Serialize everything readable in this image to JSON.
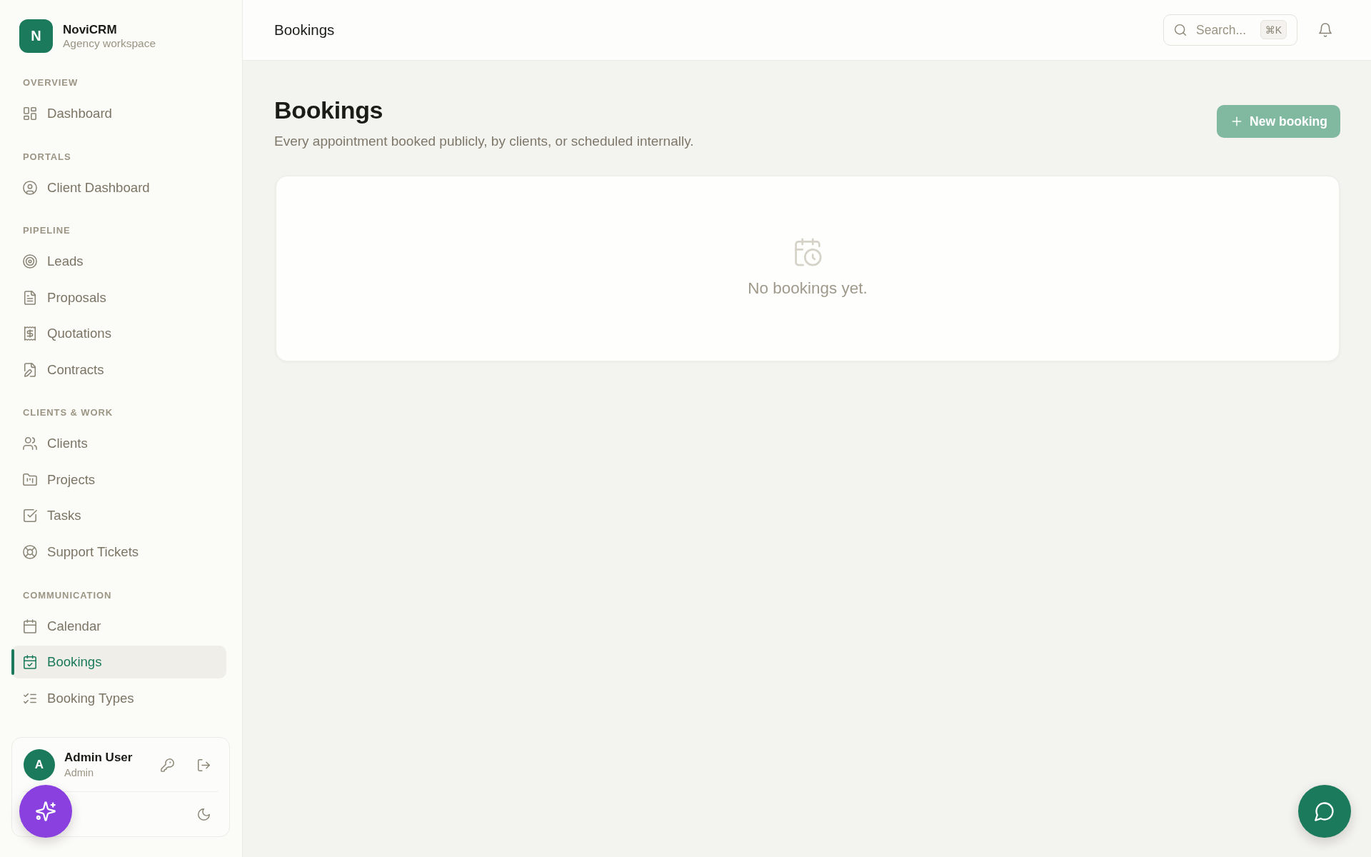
{
  "sidebar": {
    "brand": {
      "logo": "N",
      "name": "NoviCRM",
      "workspace": "Agency workspace"
    },
    "sections": [
      {
        "title": "OVERVIEW",
        "items": [
          {
            "label": "Dashboard",
            "selected": false
          }
        ]
      },
      {
        "title": "PORTALS",
        "items": [
          {
            "label": "Client Dashboard",
            "selected": false
          }
        ]
      },
      {
        "title": "PIPELINE",
        "items": [
          {
            "label": "Leads",
            "selected": false
          },
          {
            "label": "Proposals",
            "selected": false
          },
          {
            "label": "Quotations",
            "selected": false
          },
          {
            "label": "Contracts",
            "selected": false
          }
        ]
      },
      {
        "title": "CLIENTS & WORK",
        "items": [
          {
            "label": "Clients",
            "selected": false
          },
          {
            "label": "Projects",
            "selected": false
          },
          {
            "label": "Tasks",
            "selected": false
          },
          {
            "label": "Support Tickets",
            "selected": false
          }
        ]
      },
      {
        "title": "COMMUNICATION",
        "items": [
          {
            "label": "Calendar",
            "selected": false
          },
          {
            "label": "Bookings",
            "selected": true
          },
          {
            "label": "Booking Types",
            "selected": false
          }
        ]
      }
    ],
    "user": {
      "avatar": "A",
      "name": "Admin User",
      "role": "Admin"
    }
  },
  "topbar": {
    "title": "Bookings",
    "search": {
      "placeholder": "Search...",
      "shortcut": "⌘K"
    }
  },
  "page_header": {
    "title": "Bookings",
    "subtitle": "Every appointment booked publicly, by clients, or scheduled internally.",
    "button": "New booking"
  },
  "bookings_panel": {
    "empty_message": "No bookings yet."
  }
}
